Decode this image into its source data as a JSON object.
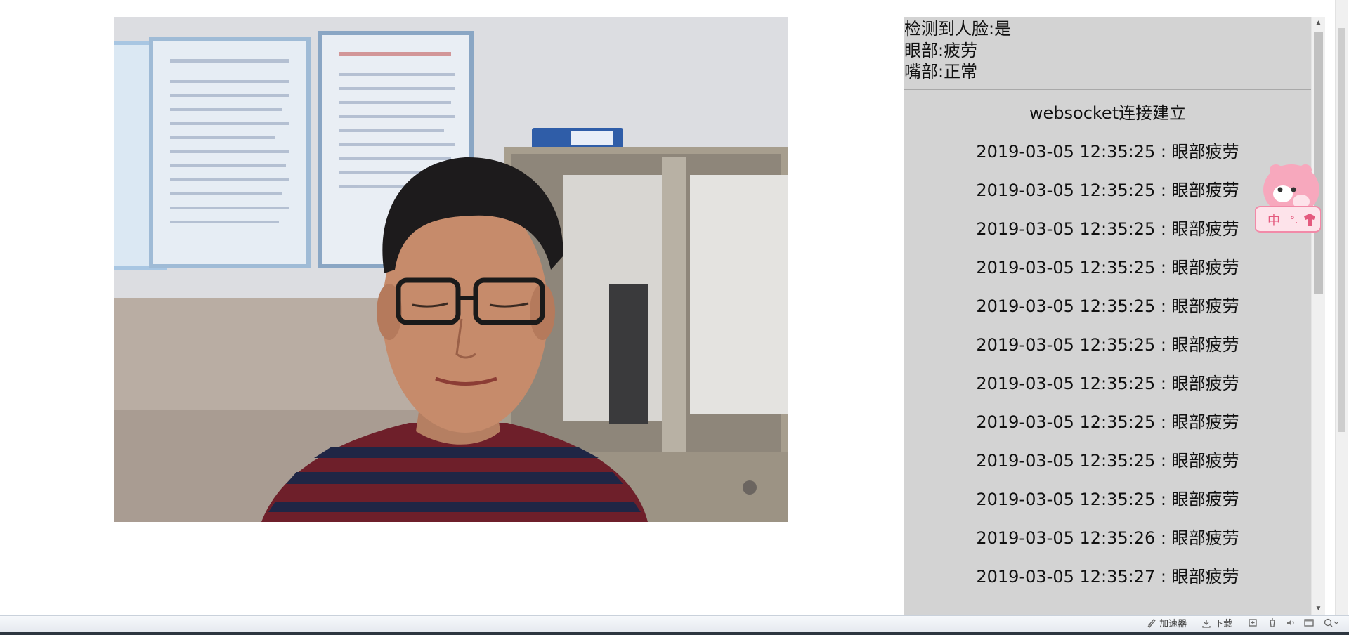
{
  "status": {
    "face_detected": "检测到人脸:是",
    "eyes": "眼部:疲劳",
    "mouth": "嘴部:正常"
  },
  "log": {
    "title": "websocket连接建立",
    "entries": [
      "2019-03-05 12:35:25 : 眼部疲劳",
      "2019-03-05 12:35:25 : 眼部疲劳",
      "2019-03-05 12:35:25 : 眼部疲劳",
      "2019-03-05 12:35:25 : 眼部疲劳",
      "2019-03-05 12:35:25 : 眼部疲劳",
      "2019-03-05 12:35:25 : 眼部疲劳",
      "2019-03-05 12:35:25 : 眼部疲劳",
      "2019-03-05 12:35:25 : 眼部疲劳",
      "2019-03-05 12:35:25 : 眼部疲劳",
      "2019-03-05 12:35:25 : 眼部疲劳",
      "2019-03-05 12:35:26 : 眼部疲劳",
      "2019-03-05 12:35:27 : 眼部疲劳"
    ]
  },
  "statusbar": {
    "accelerator": "加速器",
    "download": "下载"
  },
  "widget": {
    "ime_char": "中"
  },
  "icons": {
    "scroll_up": "scroll-up-arrow-icon",
    "scroll_down": "scroll-down-arrow-icon",
    "accelerator": "rocket-icon",
    "download": "download-icon",
    "screenshot": "crop-icon",
    "trash": "trash-icon",
    "sound": "speaker-icon",
    "window": "window-icon",
    "zoom": "zoom-icon"
  },
  "colors": {
    "panel_bg": "#d3d3d3",
    "statusbar_bg": "#eef1f5",
    "widget_pink": "#f7a8bd"
  }
}
